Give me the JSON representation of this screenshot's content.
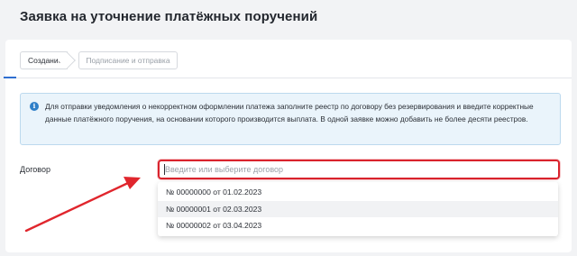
{
  "page": {
    "title": "Заявка на уточнение платёжных поручений"
  },
  "steps": [
    {
      "label": "Создание",
      "active": true
    },
    {
      "label": "Подписание и отправка",
      "active": false
    }
  ],
  "info": {
    "icon": "info-icon",
    "text": "Для отправки уведомления о некорректном оформлении платежа заполните реестр по договору без резервирования и введите корректные данные платёжного поручения, на основании которого производится выплата. В одной заявке можно добавить не более десяти реестров."
  },
  "contract_field": {
    "label": "Договор",
    "placeholder": "Введите или выберите договор",
    "value": "",
    "options": [
      "№ 00000000 от 01.02.2023",
      "№ 00000001 от 02.03.2023",
      "№ 00000002 от 03.04.2023"
    ]
  },
  "colors": {
    "accent": "#2f6fd0",
    "highlight": "#d9232d",
    "info_bg": "#eaf4fb"
  }
}
